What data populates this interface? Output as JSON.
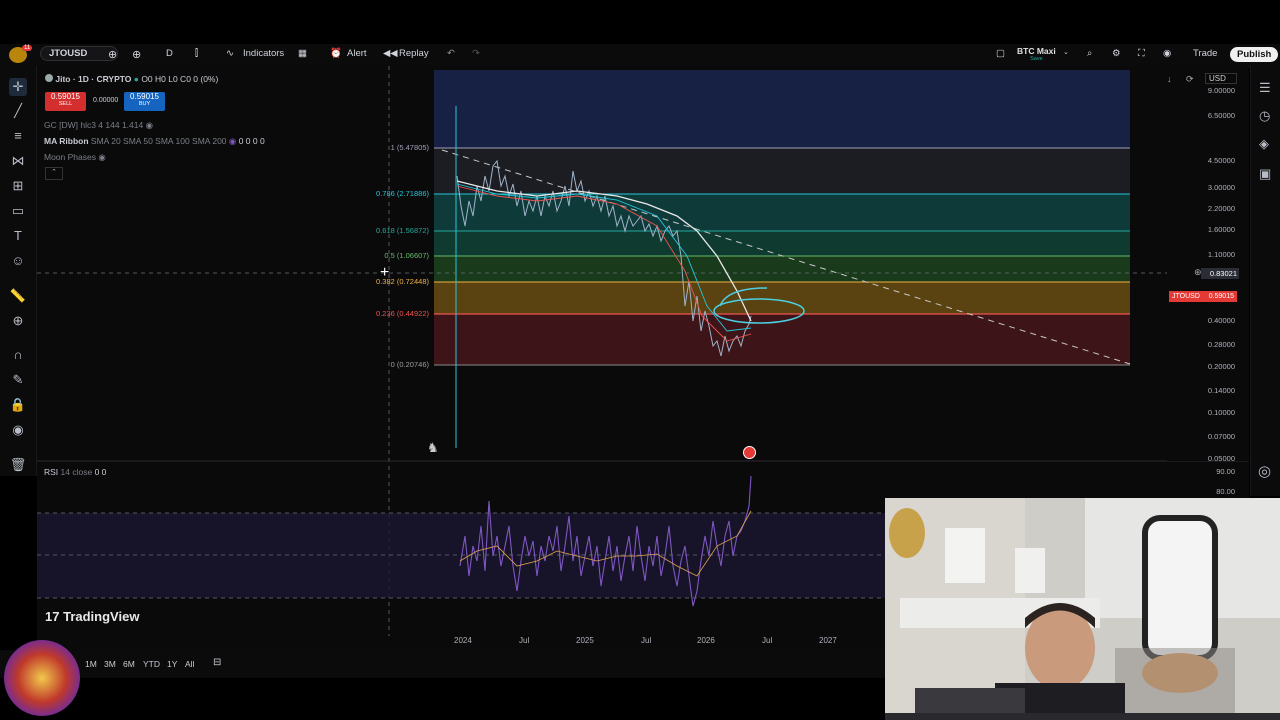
{
  "topbar": {
    "symbol": "JTOUSD",
    "interval": "D",
    "indicators_label": "Indicators",
    "alert_label": "Alert",
    "replay_label": "Replay",
    "layout_name": "BTC Maxi",
    "layout_sub": "Save",
    "trade_label": "Trade",
    "publish_label": "Publish",
    "notif_badge": "11"
  },
  "legend": {
    "title": "Jito · 1D · CRYPTO",
    "ohlc": "O0 H0 L0 C0 0 (0%)",
    "sell_price": "0.59015",
    "sell_label": "SELL",
    "spread": "0.00000",
    "buy_price": "0.59015",
    "buy_label": "BUY",
    "ind1": "GC [DW] hlc3 4 144 1.414",
    "ind2_name": "MA Ribbon",
    "ind2_params": "SMA 20 SMA 50 SMA 100 SMA 200",
    "ind2_values": "0 0 0 0",
    "ind3": "Moon Phases"
  },
  "fib_levels": [
    {
      "label": "1 (5.47805)",
      "color": "#a0a0b8"
    },
    {
      "label": "0.786 (2.71886)",
      "color": "#26c6da"
    },
    {
      "label": "0.618 (1.56872)",
      "color": "#26a69a"
    },
    {
      "label": "0.5 (1.06607)",
      "color": "#66bb6a"
    },
    {
      "label": "0.382 (0.72448)",
      "color": "#f0b040"
    },
    {
      "label": "0.236 (0.44922)",
      "color": "#ef5350"
    },
    {
      "label": "0 (0.20746)",
      "color": "#9e9e9e"
    }
  ],
  "price_axis": {
    "currency": "USD",
    "ticks": [
      "9.00000",
      "6.50000",
      "4.50000",
      "3.00000",
      "2.20000",
      "1.60000",
      "1.10000",
      "0.40000",
      "0.28000",
      "0.20000",
      "0.14000",
      "0.10000",
      "0.07000",
      "0.05000"
    ],
    "crosshair_price": "0.83021",
    "last_symbol": "JTOUSD",
    "last_price": "0.59015"
  },
  "rsi": {
    "label": "RSI",
    "params": "14 close",
    "values": "0 0",
    "ticks": [
      "90.00",
      "80.00"
    ]
  },
  "time_axis": [
    "2024",
    "Jul",
    "2025",
    "Jul",
    "2026",
    "Jul",
    "2027"
  ],
  "bottombar": {
    "periods": [
      "1M",
      "3M",
      "6M",
      "YTD",
      "1Y",
      "All"
    ]
  },
  "watermark": "TradingView",
  "colors": {
    "background": "#0a0a0b",
    "sell": "#d32f2f",
    "buy": "#1565c0",
    "accent_last": "#e53935",
    "rsi_line": "#7e57c2"
  }
}
